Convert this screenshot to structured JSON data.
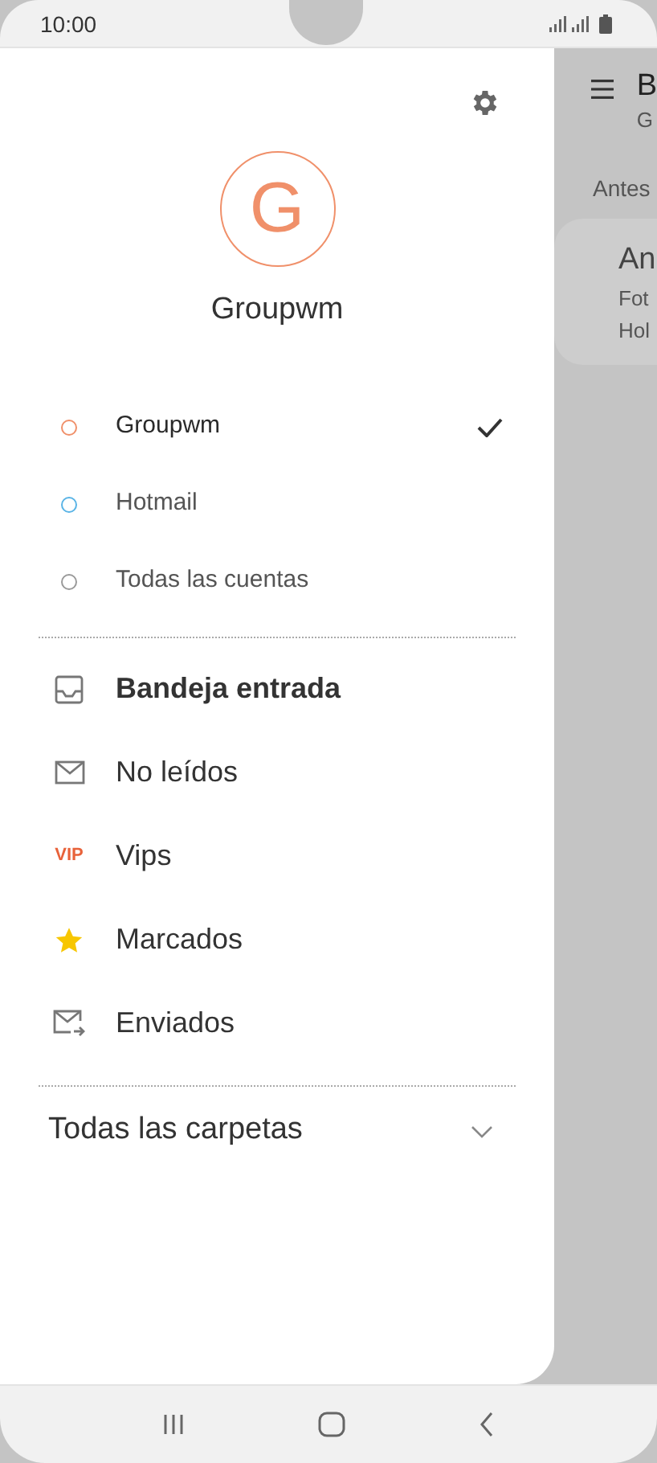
{
  "status_bar": {
    "time": "10:00"
  },
  "drawer": {
    "avatar_initial": "G",
    "account_name": "Groupwm",
    "accounts": [
      {
        "name": "Groupwm",
        "color": "#f0906a",
        "selected": true
      },
      {
        "name": "Hotmail",
        "color": "#5ab4e6",
        "selected": false
      },
      {
        "name": "Todas las cuentas",
        "color": "#9a9a9a",
        "selected": false
      }
    ],
    "folders": [
      {
        "label": "Bandeja entrada",
        "kind": "inbox",
        "selected": true
      },
      {
        "label": "No leídos",
        "kind": "unread",
        "selected": false
      },
      {
        "label": "Vips",
        "kind": "vip",
        "badge": "VIP",
        "selected": false
      },
      {
        "label": "Marcados",
        "kind": "starred",
        "selected": false
      },
      {
        "label": "Enviados",
        "kind": "sent",
        "selected": false
      }
    ],
    "all_folders": {
      "label": "Todas las carpetas",
      "expanded": false
    }
  },
  "background_app": {
    "title": "B",
    "subtitle": "G",
    "section": "Antes",
    "card": {
      "title": "An",
      "lines": [
        "Fot",
        "Hol"
      ]
    }
  }
}
